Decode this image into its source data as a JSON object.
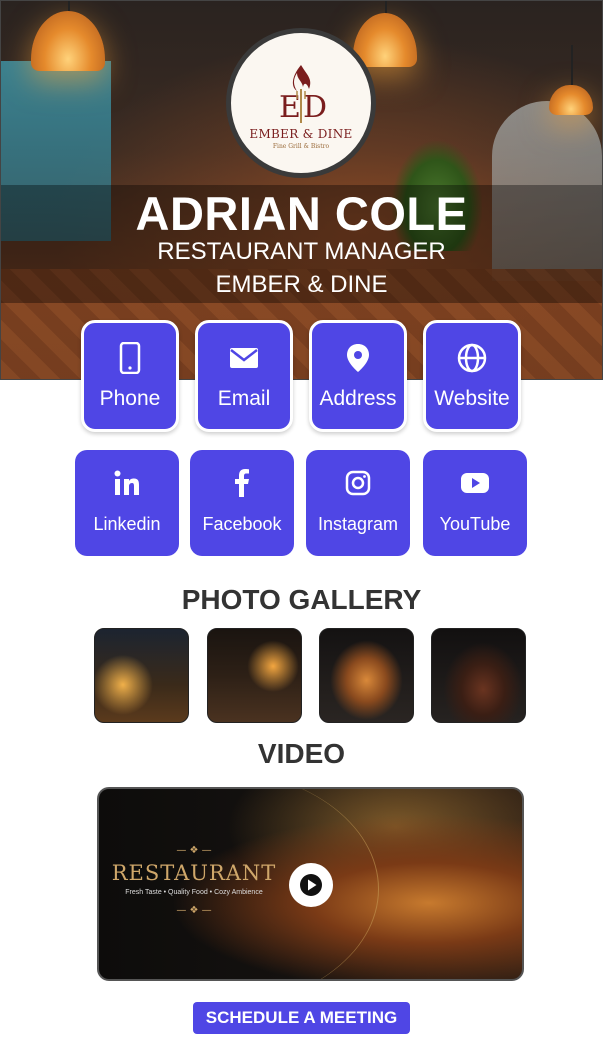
{
  "profile": {
    "name": "ADRIAN COLE",
    "title": "RESTAURANT MANAGER",
    "company": "EMBER & DINE"
  },
  "logo": {
    "brand": "EMBER & DINE",
    "tagline": "Fine Grill & Bistro",
    "icon": "flame-fork-logo-icon"
  },
  "contact_buttons": [
    {
      "label": "Phone",
      "icon": "phone-icon"
    },
    {
      "label": "Email",
      "icon": "email-icon"
    },
    {
      "label": "Address",
      "icon": "location-pin-icon"
    },
    {
      "label": "Website",
      "icon": "globe-icon"
    }
  ],
  "social_buttons": [
    {
      "label": "Linkedin",
      "icon": "linkedin-icon"
    },
    {
      "label": "Facebook",
      "icon": "facebook-icon"
    },
    {
      "label": "Instagram",
      "icon": "instagram-icon"
    },
    {
      "label": "YouTube",
      "icon": "youtube-icon"
    }
  ],
  "gallery": {
    "title": "PHOTO GALLERY"
  },
  "video": {
    "title": "VIDEO",
    "thumb_title": "RESTAURANT",
    "thumb_subtitle": "Fresh Taste • Quality Food • Cozy Ambience"
  },
  "cta": {
    "label": "SCHEDULE A MEETING"
  },
  "colors": {
    "accent": "#4f46e5",
    "heading": "#333333",
    "logo_text": "#7a1d1d"
  }
}
